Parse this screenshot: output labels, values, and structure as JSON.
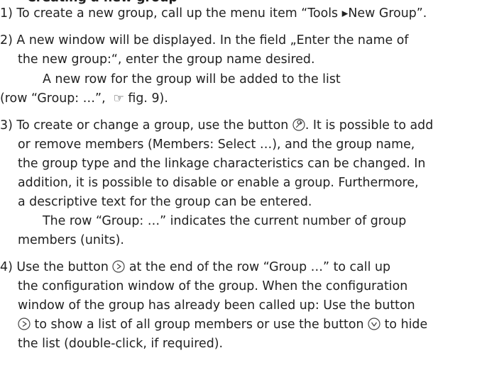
{
  "heading": "Creating a new group",
  "items": [
    {
      "number": "1)",
      "lines": [
        [
          "To create a new group, call up the menu item “Tools ",
          "New Group”."
        ]
      ]
    },
    {
      "number": "2)",
      "lines": [
        "A new window will be displayed. In the field „Enter the name of",
        "the new group:“, enter the group name desired.",
        "A new row for the group will be added to the list",
        [
          "(row “Group: …”,  ",
          " fig. 9)."
        ]
      ]
    },
    {
      "number": "3)",
      "lines": [
        [
          "To create or change a group, use the button ",
          ". It is possible to add"
        ],
        "or remove members (Members: Select …), and the group name,",
        "the group type and the linkage characteristics can be changed. In",
        "addition, it is possible to disable or enable a group. Furthermore,",
        "a descriptive text for the group can be entered.",
        "The row “Group: …” indicates the current number of group",
        "members (units)."
      ]
    },
    {
      "number": "4)",
      "lines": [
        [
          "Use the button ",
          " at the end of the row “Group …” to call up"
        ],
        "the configuration window of the group. When the configuration",
        "window of the group has already been called up: Use the button",
        [
          "",
          " to show a list of all group members or use the button ",
          " to hide"
        ],
        "the list (double-click, if required)."
      ]
    }
  ]
}
